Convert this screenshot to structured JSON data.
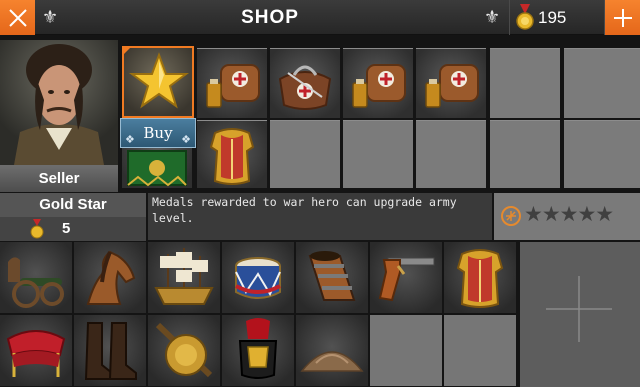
{
  "header": {
    "title": "SHOP",
    "gold": "195",
    "colors": {
      "accent": "#f07a22",
      "bar": "#2e2e2e"
    }
  },
  "seller": {
    "label": "Seller"
  },
  "shop": {
    "buy_label": "Buy",
    "items": [
      {
        "name": "gold-star",
        "icon": "star"
      },
      {
        "name": "medic-satchel",
        "icon": "satchel"
      },
      {
        "name": "surgeon-kit",
        "icon": "bag"
      },
      {
        "name": "medic-satchel",
        "icon": "satchel"
      },
      {
        "name": "medic-satchel",
        "icon": "satchel"
      },
      {
        "name": "green-banner",
        "icon": "flag"
      },
      {
        "name": "cuirass",
        "icon": "armor"
      }
    ]
  },
  "selected_item": {
    "name": "Gold Star",
    "level": "5",
    "description": "Medals rewarded to war hero can upgrade army level.",
    "rank_stars": 5
  },
  "inventory": [
    {
      "name": "field-cannon",
      "icon": "cannon"
    },
    {
      "name": "cavalry-horse",
      "icon": "horse"
    },
    {
      "name": "sailing-ship",
      "icon": "ship"
    },
    {
      "name": "war-drum",
      "icon": "drum"
    },
    {
      "name": "cannon-barrel",
      "icon": "barrel"
    },
    {
      "name": "flintlock-pistol",
      "icon": "pistol"
    },
    {
      "name": "cuirass",
      "icon": "armor"
    },
    {
      "name": "saddle",
      "icon": "saddle"
    },
    {
      "name": "riding-boots",
      "icon": "boots"
    },
    {
      "name": "lion-figurehead",
      "icon": "lion"
    },
    {
      "name": "plumed-helmet",
      "icon": "helmet"
    },
    {
      "name": "gunpowder-pile",
      "icon": "powder"
    }
  ]
}
